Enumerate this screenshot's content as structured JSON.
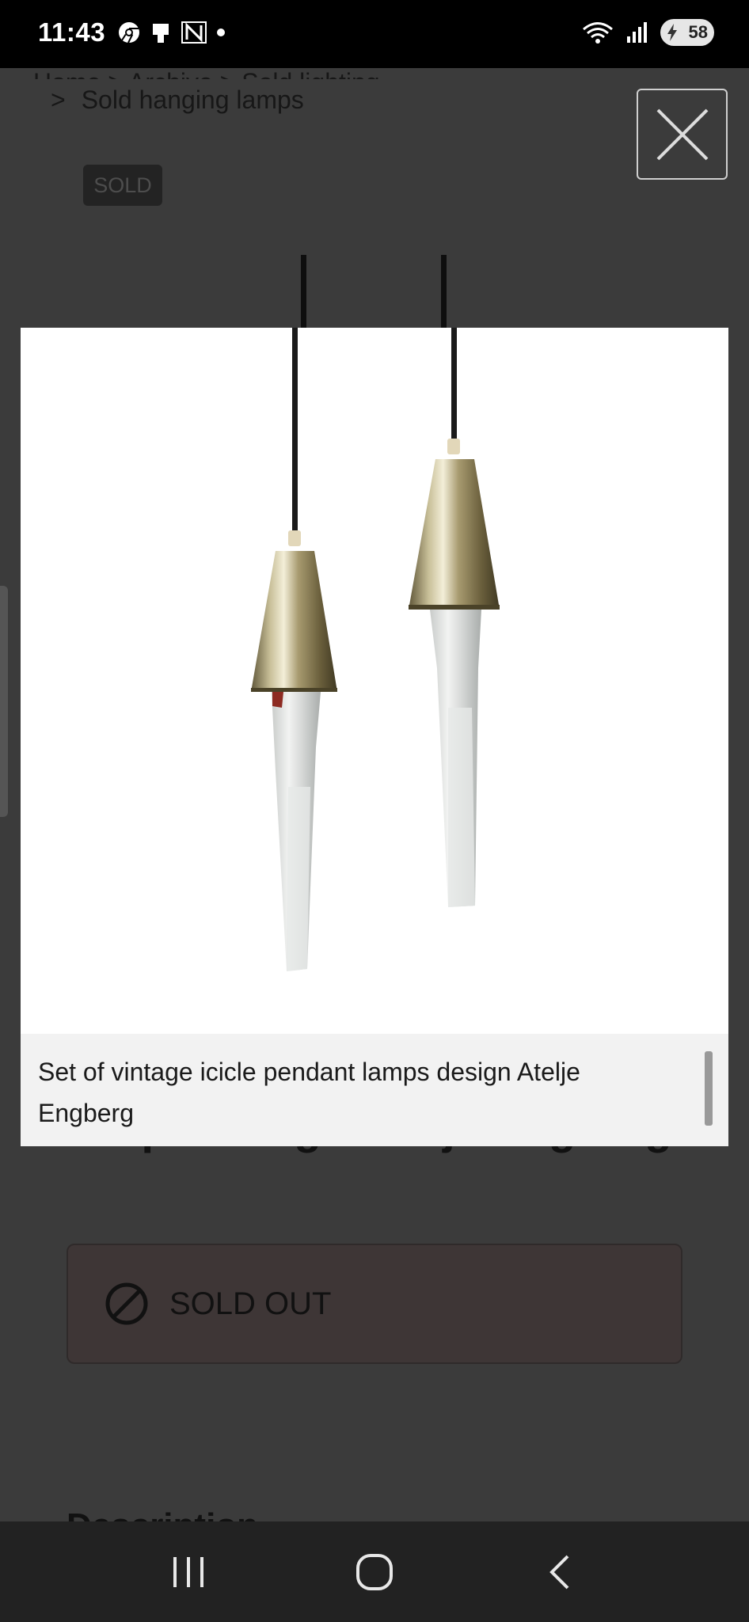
{
  "status_bar": {
    "time": "11:43",
    "battery_level": "58"
  },
  "page": {
    "breadcrumb_top": "Home  >  Archive  >  Sold lighting",
    "breadcrumb_arrow": ">",
    "breadcrumb_current": "Sold hanging lamps",
    "sold_tag": "SOLD",
    "product_title_partial": "lamps design Atelje Engberg",
    "sold_out_label": "SOLD OUT",
    "description_heading_partial": "Description"
  },
  "lightbox": {
    "caption": "Set of vintage icicle pendant lamps design Atelje Engberg",
    "image_alt": "Two vintage icicle pendant lamps with brass shades and clear glass icicles"
  },
  "colors": {
    "overlay_bg": "#383838",
    "brass": "#b8ad86",
    "status_bar_bg": "#000000",
    "nav_bar_bg": "#222222"
  },
  "icons": {
    "close": "close-icon",
    "sold_out": "no-symbol-icon",
    "nav_recents": "recents-icon",
    "nav_home": "home-icon",
    "nav_back": "back-icon"
  }
}
